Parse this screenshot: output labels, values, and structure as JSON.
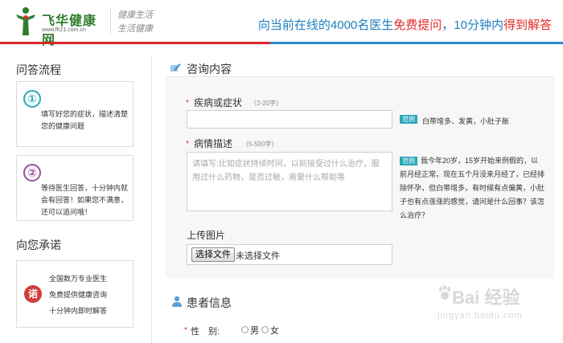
{
  "header": {
    "logo_title": "飞华健康网",
    "logo_url": "www.fh21.com.cn",
    "slogan_line1": "健康生活",
    "slogan_line2": "生活健康",
    "banner_part1": "向当前在线的4000名医生",
    "banner_highlight1": "免费提问",
    "banner_part2": "，10分钟内",
    "banner_highlight2": "得到解答",
    "brand_green": "#2f7d2f",
    "accent_blue": "#1f7fbf",
    "accent_red": "#e02b2b"
  },
  "sidebar": {
    "process_heading": "问答流程",
    "steps": [
      {
        "number": "①",
        "text": "填写好您的症状，描述清楚您的健康问题",
        "color": "#2aa7b8"
      },
      {
        "number": "②",
        "text": "等待医生回答，十分钟内就会有回答！如果您不满意，还可以追问哦！",
        "color": "#9b4fa0"
      }
    ],
    "promise_heading": "向您承诺",
    "promise_icon": "诺",
    "promises": [
      "全国数万专业医生",
      "免费提供健康咨询",
      "十分钟内即时解答"
    ]
  },
  "consult": {
    "title": "咨询内容",
    "disease_label": "疾病或症状",
    "disease_hint": "（2-20字）",
    "disease_value": "",
    "example_tag": "范例",
    "disease_example": "白带增多、发黄，小肚子胀",
    "desc_label": "病情描述",
    "desc_hint": "（5-500字）",
    "desc_placeholder": "请填写:比如症状持续时间，以前接受过什么治疗，服用过什么药物，是否过敏，需要什么帮助等",
    "desc_example": "我今年20岁，15岁开始来例假的，以前月经正常，现在五个月没来月经了，已经排除怀孕，但白带增多，有时候有点偏黄，小肚子也有点涨涨的感觉，请问是什么回事？该怎么治疗？",
    "upload_label": "上传图片",
    "file_button": "选择文件",
    "file_status": "未选择文件"
  },
  "patient": {
    "title": "患者信息",
    "gender_label": "性　别:",
    "gender_options": [
      "男",
      "女"
    ]
  },
  "watermark": {
    "main": "Bai 经验",
    "sub": "jingyan.baidu.com"
  }
}
